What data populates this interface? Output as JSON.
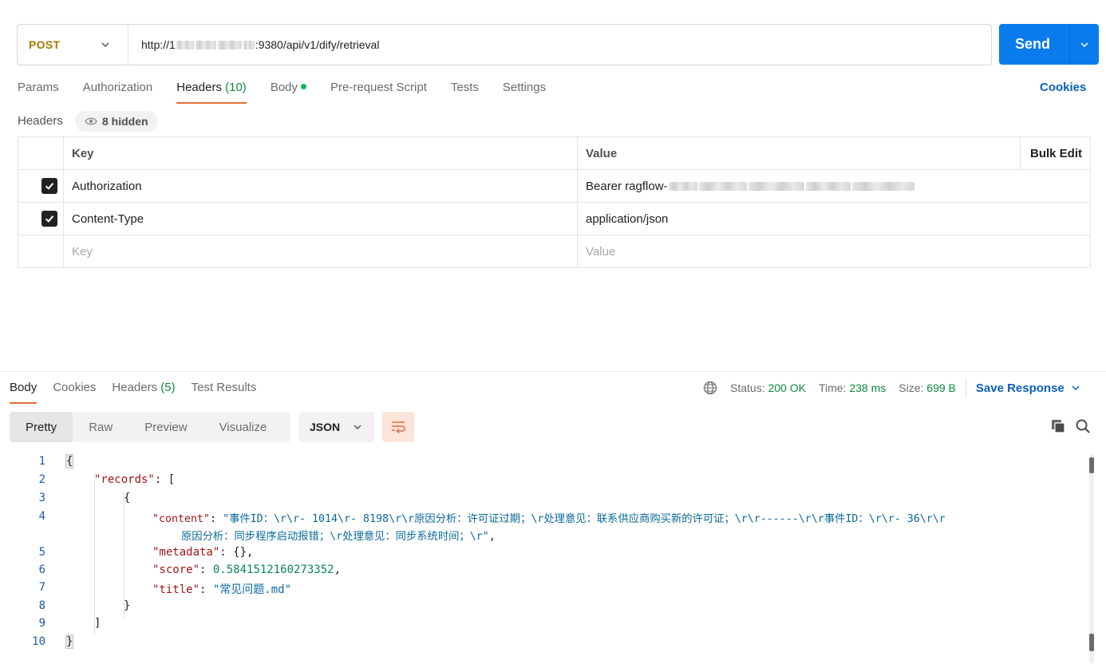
{
  "request": {
    "method": "POST",
    "url_prefix": "http://1",
    "url_suffix": ":9380/api/v1/dify/retrieval",
    "send_label": "Send"
  },
  "req_tabs": {
    "params": "Params",
    "authorization": "Authorization",
    "headers": "Headers",
    "headers_count": "(10)",
    "body": "Body",
    "prerequest": "Pre-request Script",
    "tests": "Tests",
    "settings": "Settings",
    "cookies": "Cookies"
  },
  "headers_section": {
    "title": "Headers",
    "hidden": "8 hidden",
    "col_key": "Key",
    "col_value": "Value",
    "bulk_edit": "Bulk Edit",
    "rows": [
      {
        "key": "Authorization",
        "value": "Bearer ragflow-",
        "checked": true
      },
      {
        "key": "Content-Type",
        "value": "application/json",
        "checked": true
      }
    ],
    "key_placeholder": "Key",
    "value_placeholder": "Value"
  },
  "response": {
    "tabs": {
      "body": "Body",
      "cookies": "Cookies",
      "headers": "Headers",
      "headers_count": "(5)",
      "test_results": "Test Results"
    },
    "status_label": "Status:",
    "status_value": "200 OK",
    "time_label": "Time:",
    "time_value": "238 ms",
    "size_label": "Size:",
    "size_value": "699 B",
    "save_response": "Save Response",
    "views": {
      "pretty": "Pretty",
      "raw": "Raw",
      "preview": "Preview",
      "visualize": "Visualize"
    },
    "format": "JSON"
  },
  "code": {
    "line_numbers": [
      "1",
      "2",
      "3",
      "4",
      "5",
      "6",
      "7",
      "8",
      "9",
      "10"
    ],
    "l1": "{",
    "l2_key": "\"records\"",
    "l2_rest": ": [",
    "l3": "{",
    "l4_key": "\"content\"",
    "l4_sep": ": ",
    "l4_val_a": "\"事件ID：\\r\\r- 1014\\r- 8198\\r\\r原因分析：许可证过期；\\r处理意见：联系供应商购买新的许可证；\\r\\r------\\r\\r事件ID：\\r\\r- 36\\r\\r",
    "l4_val_b": "原因分析：同步程序启动报错；\\r处理意见：同步系统时间；\\r\"",
    "l4_end": ",",
    "l5_key": "\"metadata\"",
    "l5_rest": ": {},",
    "l6_key": "\"score\"",
    "l6_sep": ": ",
    "l6_val": "0.5841512160273352",
    "l6_end": ",",
    "l7_key": "\"title\"",
    "l7_sep": ": ",
    "l7_val": "\"常见问题.md\"",
    "l8": "}",
    "l9": "]",
    "l10": "}"
  },
  "icons": {
    "eye": "eye-icon",
    "globe": "globe-icon",
    "copy": "copy-icon",
    "search": "search-icon",
    "wrap": "wrap-lines-icon",
    "chevron": "chevron-down-icon",
    "check": "check-icon"
  },
  "colors": {
    "send": "#097bed",
    "method": "#a47a00",
    "active_tab": "#e36c3a",
    "success": "#0b8a3e",
    "link": "#0b5fb8"
  }
}
